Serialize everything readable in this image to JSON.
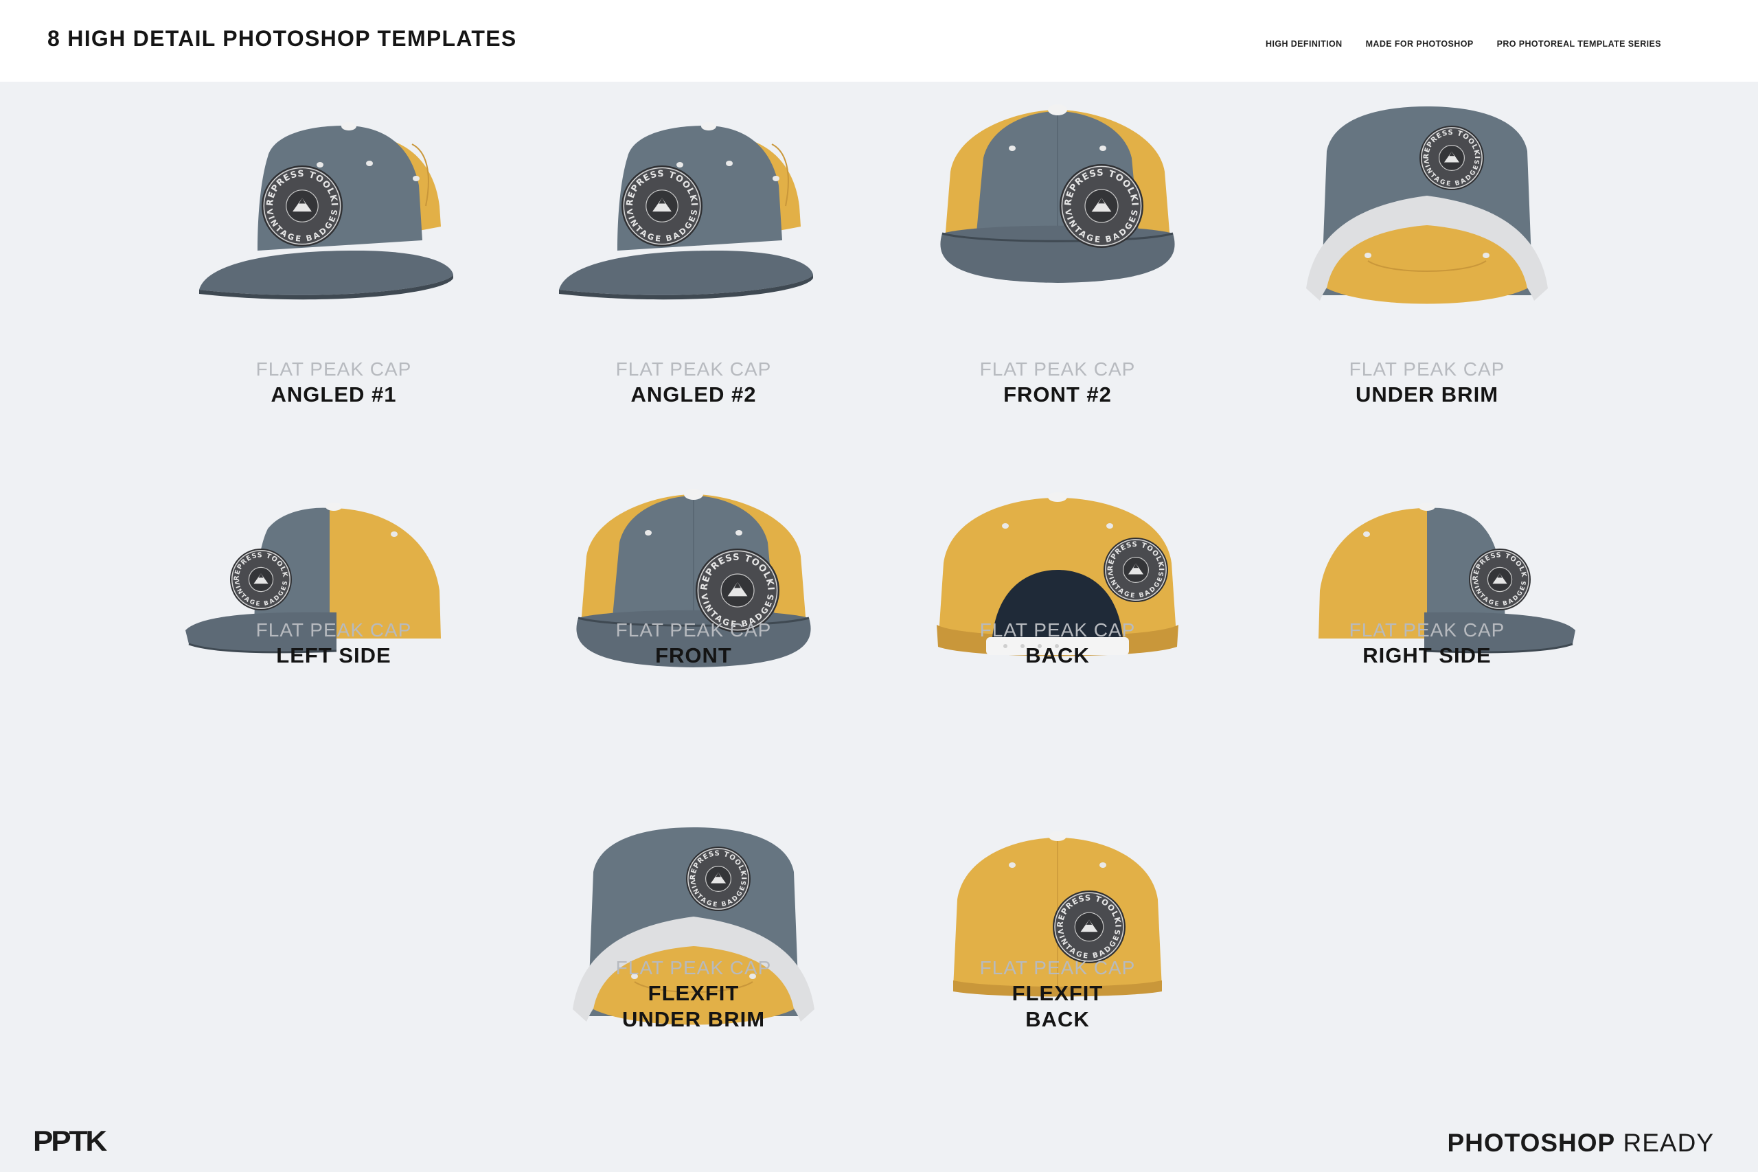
{
  "header": {
    "title": "8 HIGH DETAIL PHOTOSHOP TEMPLATES",
    "tags": [
      "HIGH DEFINITION",
      "MADE FOR PHOTOSHOP",
      "PRO PHOTOREAL TEMPLATE SERIES"
    ]
  },
  "colors": {
    "grey": "#667581",
    "yellow": "#e2b047",
    "background": "#eff1f4"
  },
  "badge": {
    "top": "PREPRESS TOOLKIT",
    "bottom": "VINTAGE BADGES"
  },
  "cards": [
    {
      "view": "angled",
      "sub": "FLAT PEAK CAP",
      "name": "ANGLED #1"
    },
    {
      "view": "angled",
      "sub": "FLAT PEAK CAP",
      "name": "ANGLED #2"
    },
    {
      "view": "front",
      "sub": "FLAT PEAK CAP",
      "name": "FRONT #2"
    },
    {
      "view": "under",
      "sub": "FLAT PEAK CAP",
      "name": "UNDER BRIM"
    },
    {
      "view": "left",
      "sub": "FLAT PEAK CAP",
      "name": "LEFT SIDE"
    },
    {
      "view": "front",
      "sub": "FLAT PEAK CAP",
      "name": "FRONT"
    },
    {
      "view": "back",
      "sub": "FLAT PEAK CAP",
      "name": "BACK"
    },
    {
      "view": "right",
      "sub": "FLAT PEAK CAP",
      "name": "RIGHT SIDE"
    },
    {
      "view": "under",
      "sub": "FLAT PEAK CAP",
      "name": "FLEXFIT",
      "name2": "UNDER BRIM"
    },
    {
      "view": "flexback",
      "sub": "FLAT PEAK CAP",
      "name": "FLEXFIT",
      "name2": "BACK"
    }
  ],
  "footer": {
    "logo": "PPTK",
    "ready_bold": "PHOTOSHOP",
    "ready_light": "READY"
  }
}
